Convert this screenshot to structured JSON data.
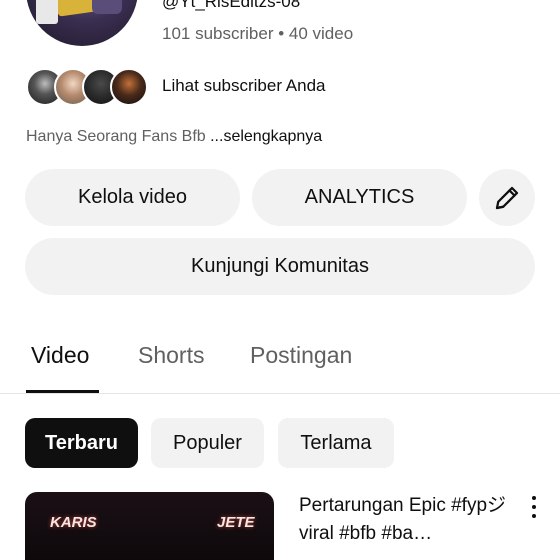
{
  "channel": {
    "handle": "@Yt_RisEditzs-08",
    "stats": "101 subscriber • 40 video",
    "subscribers_link": "Lihat subscriber Anda",
    "description": "Hanya Seorang Fans Bfb ",
    "description_more": "...selengkapnya"
  },
  "actions": {
    "manage_videos": "Kelola video",
    "analytics": "ANALYTICS",
    "edit_icon": "pencil-icon",
    "visit_community": "Kunjungi Komunitas"
  },
  "tabs": [
    {
      "label": "Video",
      "active": true
    },
    {
      "label": "Shorts",
      "active": false
    },
    {
      "label": "Postingan",
      "active": false
    }
  ],
  "filters": [
    {
      "label": "Terbaru",
      "selected": true
    },
    {
      "label": "Populer",
      "selected": false
    },
    {
      "label": "Terlama",
      "selected": false
    }
  ],
  "videos": [
    {
      "title": "Pertarungan Epic #fypジviral #bfb #ba…",
      "thumbnail_text_left": "KARIS",
      "thumbnail_text_right": "JETE"
    }
  ],
  "colors": {
    "pill_bg": "#f2f2f2",
    "text_primary": "#0f0f0f",
    "text_secondary": "#606060",
    "chip_selected_bg": "#0f0f0f"
  }
}
